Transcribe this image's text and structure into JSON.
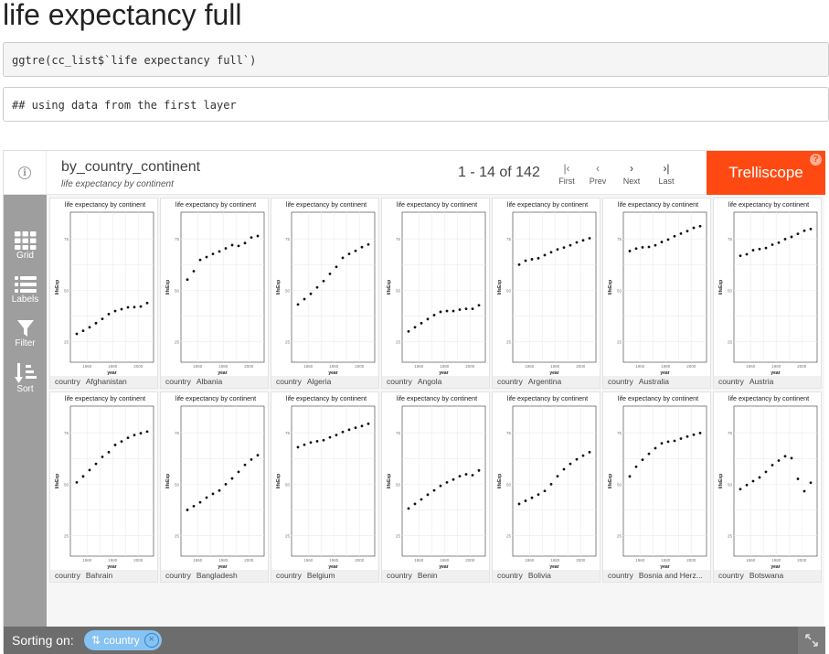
{
  "doc": {
    "title": "life expectancy full",
    "code": "ggtre(cc_list$`life expectancy full`)",
    "output": "## using data from the first layer"
  },
  "trelliscope": {
    "display_name": "by_country_continent",
    "display_desc": "life expectancy by continent",
    "pager_text": "1 - 14 of 142",
    "nav": {
      "first": "First",
      "prev": "Prev",
      "next": "Next",
      "last": "Last"
    },
    "brand": "Trelliscope",
    "help": "?",
    "info_icon": "i",
    "sidebar": {
      "grid": "Grid",
      "labels": "Labels",
      "filter": "Filter",
      "sort": "Sort"
    },
    "footer": {
      "sorting_on": "Sorting on:",
      "sort_chip": "country"
    },
    "panel_title": "life expectancy by continent",
    "axis": {
      "xlabel": "year",
      "ylabel": "lifeExp",
      "yticks": [
        "75",
        "50",
        "25"
      ],
      "xticks": [
        "1960",
        "1980",
        "2000"
      ]
    },
    "label_key": "country",
    "accent": "#fe4a12"
  },
  "chart_data": {
    "type": "scatter",
    "title": "life expectancy by continent",
    "xlabel": "year",
    "ylabel": "lifeExp",
    "xlim": [
      1947,
      2012
    ],
    "ylim": [
      15,
      88
    ],
    "x": [
      1952,
      1957,
      1962,
      1967,
      1972,
      1977,
      1982,
      1987,
      1992,
      1997,
      2002,
      2007
    ],
    "series": [
      {
        "name": "Afghanistan",
        "values": [
          28.8,
          30.3,
          32.0,
          34.0,
          36.1,
          38.4,
          39.9,
          40.8,
          41.7,
          41.8,
          42.1,
          43.8
        ]
      },
      {
        "name": "Albania",
        "values": [
          55.2,
          59.3,
          64.8,
          66.2,
          67.7,
          68.9,
          70.4,
          72.0,
          71.6,
          73.0,
          75.7,
          76.4
        ]
      },
      {
        "name": "Algeria",
        "values": [
          43.1,
          45.7,
          48.3,
          51.4,
          54.5,
          58.0,
          61.4,
          65.8,
          67.7,
          69.2,
          71.0,
          72.3
        ]
      },
      {
        "name": "Angola",
        "values": [
          30.0,
          32.0,
          34.0,
          36.0,
          37.9,
          39.5,
          39.9,
          39.9,
          40.6,
          41.0,
          41.0,
          42.7
        ]
      },
      {
        "name": "Argentina",
        "values": [
          62.5,
          64.4,
          65.1,
          65.6,
          67.1,
          68.5,
          69.9,
          70.8,
          71.9,
          73.3,
          74.3,
          75.3
        ]
      },
      {
        "name": "Australia",
        "values": [
          69.1,
          70.3,
          70.9,
          71.1,
          71.9,
          73.5,
          74.7,
          76.3,
          77.6,
          78.8,
          80.4,
          81.2
        ]
      },
      {
        "name": "Austria",
        "values": [
          66.8,
          67.5,
          69.5,
          70.1,
          70.6,
          72.2,
          73.2,
          74.9,
          76.0,
          77.5,
          79.0,
          79.8
        ]
      },
      {
        "name": "Bahrain",
        "values": [
          50.9,
          53.8,
          56.9,
          59.9,
          63.3,
          65.6,
          69.1,
          70.8,
          72.6,
          73.9,
          74.8,
          75.6
        ]
      },
      {
        "name": "Bangladesh",
        "values": [
          37.5,
          39.3,
          41.2,
          43.5,
          45.3,
          46.9,
          50.0,
          52.8,
          56.0,
          59.4,
          62.0,
          64.1
        ]
      },
      {
        "name": "Belgium",
        "values": [
          68.0,
          69.2,
          70.3,
          70.9,
          71.4,
          72.8,
          73.9,
          75.4,
          76.5,
          77.5,
          78.3,
          79.4
        ]
      },
      {
        "name": "Benin",
        "values": [
          38.2,
          40.4,
          42.6,
          44.9,
          47.0,
          49.2,
          50.9,
          52.3,
          53.9,
          54.8,
          54.4,
          56.7
        ]
      },
      {
        "name": "Bolivia",
        "values": [
          40.4,
          41.9,
          43.4,
          45.0,
          46.7,
          50.0,
          53.9,
          57.3,
          59.9,
          62.1,
          63.9,
          65.6
        ]
      },
      {
        "name": "Bosnia and Herz...",
        "values": [
          53.8,
          58.5,
          61.9,
          64.8,
          67.5,
          69.9,
          70.7,
          71.1,
          72.2,
          73.2,
          74.1,
          74.9
        ]
      },
      {
        "name": "Botswana",
        "values": [
          47.6,
          49.6,
          51.5,
          53.3,
          56.0,
          59.3,
          61.5,
          63.6,
          62.7,
          52.6,
          46.6,
          50.7
        ]
      }
    ]
  }
}
